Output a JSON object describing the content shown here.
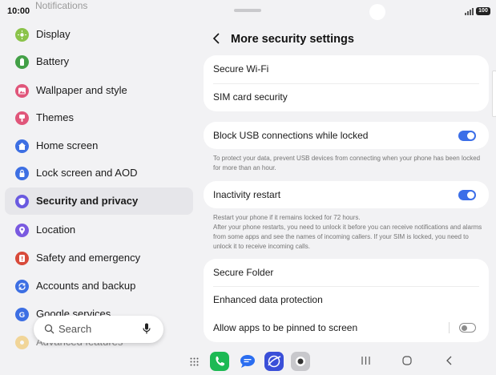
{
  "status": {
    "time": "10:00",
    "ghost_text": "Notifications",
    "battery": "100"
  },
  "sidebar": {
    "items": [
      {
        "label": "Display",
        "color": "#8bc34a",
        "icon": "sun-icon"
      },
      {
        "label": "Battery",
        "color": "#43a047",
        "icon": "battery-icon"
      },
      {
        "label": "Wallpaper and style",
        "color": "#e0567a",
        "icon": "image-icon"
      },
      {
        "label": "Themes",
        "color": "#e0567a",
        "icon": "brush-icon"
      },
      {
        "label": "Home screen",
        "color": "#3d6fe3",
        "icon": "home-icon"
      },
      {
        "label": "Lock screen and AOD",
        "color": "#3d6fe3",
        "icon": "lock-icon"
      },
      {
        "label": "Security and privacy",
        "color": "#6a5ae0",
        "icon": "shield-icon"
      },
      {
        "label": "Location",
        "color": "#7a5ae0",
        "icon": "location-pin-icon"
      },
      {
        "label": "Safety and emergency",
        "color": "#d84a3a",
        "icon": "alert-icon"
      },
      {
        "label": "Accounts and backup",
        "color": "#3d6fe3",
        "icon": "sync-icon"
      },
      {
        "label": "Google services",
        "color": "#3d6fe3",
        "icon": "google-icon"
      },
      {
        "label": "Advanced features",
        "color": "#f0b429",
        "icon": "star-icon"
      }
    ],
    "search_placeholder": "Search"
  },
  "page": {
    "title": "More security settings",
    "card1": {
      "row1": "Secure Wi-Fi",
      "row2": "SIM card security"
    },
    "usb": {
      "label": "Block USB connections while locked",
      "toggle": "on",
      "desc": "To protect your data, prevent USB devices from connecting when your phone has been locked for more than an hour."
    },
    "restart": {
      "label": "Inactivity restart",
      "toggle": "on",
      "desc1": "Restart your phone if it remains locked for 72 hours.",
      "desc2": "After your phone restarts, you need to unlock it before you can receive notifications and alarms from some apps and see the names of incoming callers. If your SIM is locked, you need to unlock it to receive incoming calls."
    },
    "card4": {
      "row1": "Secure Folder",
      "row2": "Enhanced data protection",
      "row3": "Allow apps to be pinned to screen",
      "row3_toggle": "off"
    }
  },
  "accent": "#3b6ee8"
}
